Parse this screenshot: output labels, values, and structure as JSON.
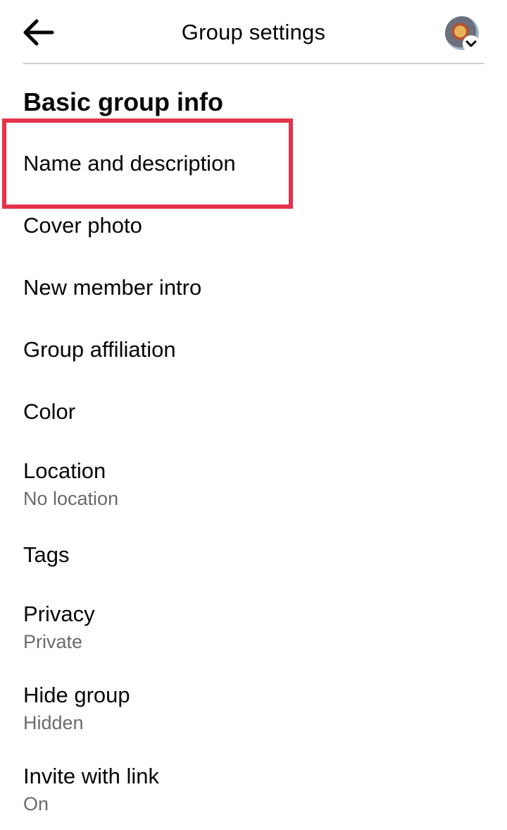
{
  "header": {
    "title": "Group settings",
    "back_icon": "arrow-left-icon",
    "avatar_icon": "profile-avatar",
    "avatar_badge_icon": "chevron-down-icon"
  },
  "section": {
    "title": "Basic group info"
  },
  "items": [
    {
      "label": "Name and description",
      "sub": null,
      "highlighted": true
    },
    {
      "label": "Cover photo",
      "sub": null
    },
    {
      "label": "New member intro",
      "sub": null
    },
    {
      "label": "Group affiliation",
      "sub": null
    },
    {
      "label": "Color",
      "sub": null
    },
    {
      "label": "Location",
      "sub": "No location"
    },
    {
      "label": "Tags",
      "sub": null
    },
    {
      "label": "Privacy",
      "sub": "Private"
    },
    {
      "label": "Hide group",
      "sub": "Hidden"
    },
    {
      "label": "Invite with link",
      "sub": "On"
    }
  ],
  "colors": {
    "highlight_border": "#e5334b",
    "secondary_text": "#6b6b6b"
  }
}
